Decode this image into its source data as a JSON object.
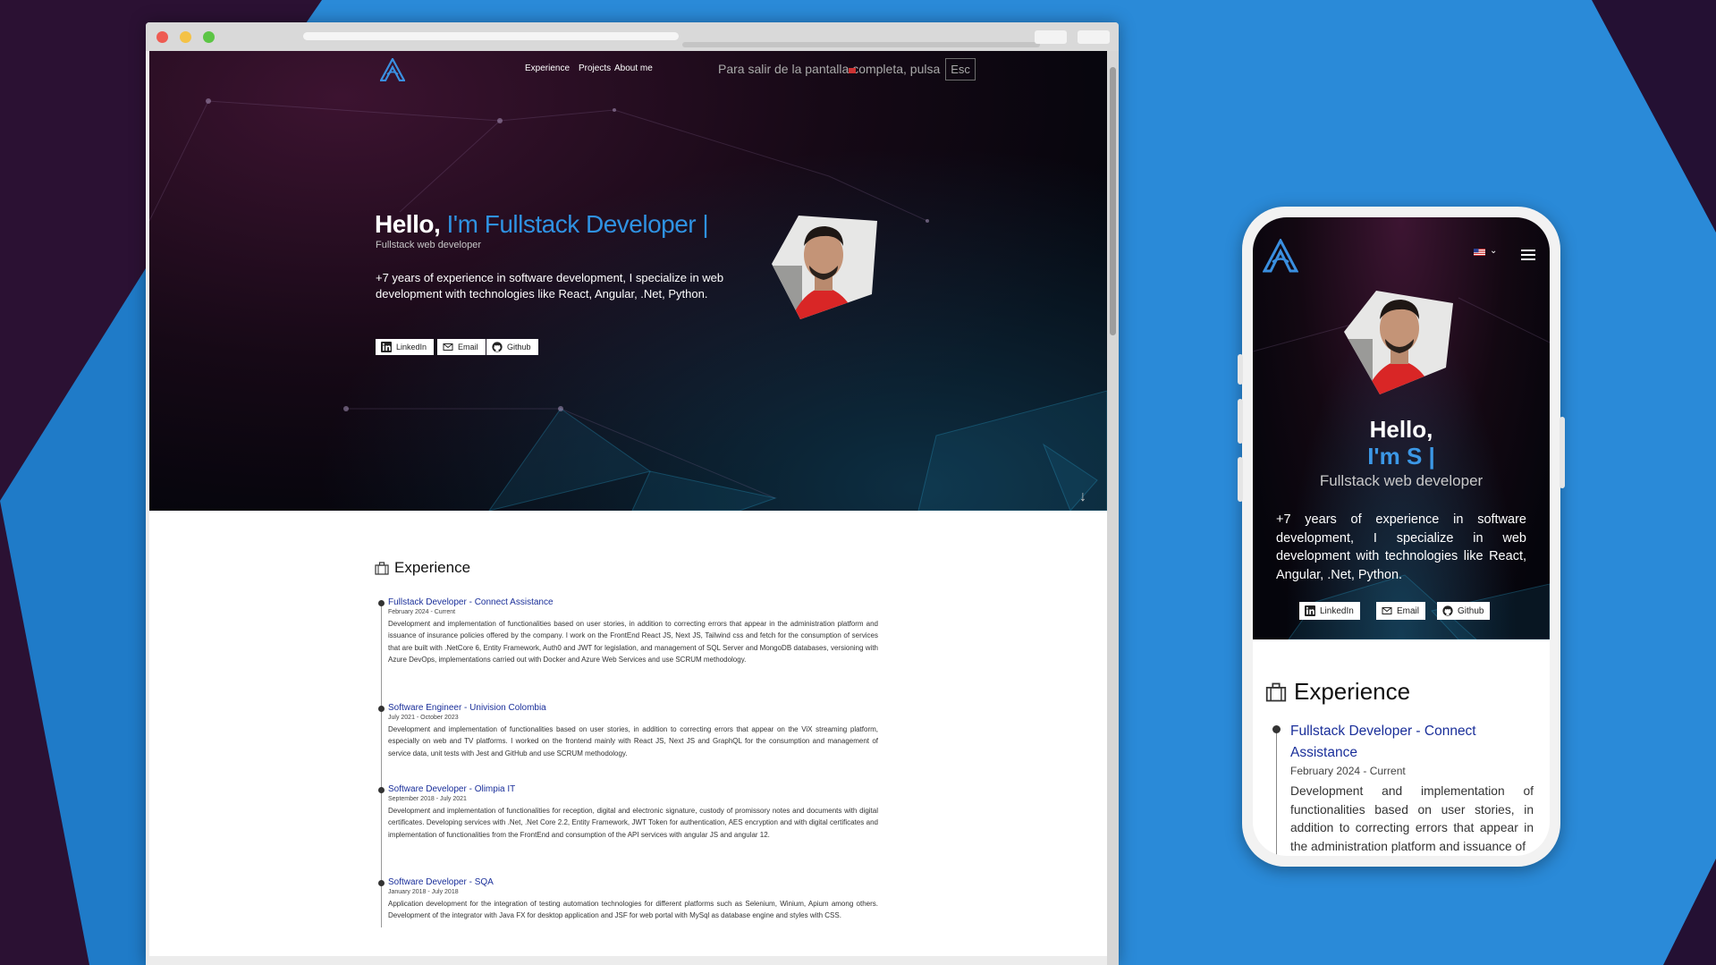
{
  "colors": {
    "background_blue": "#2a8ad8",
    "accent_blue": "#2f92e2",
    "job_title_blue": "#1a2f9a",
    "hero_dark": "#06060d"
  },
  "desktop": {
    "nav": {
      "experience": "Experience",
      "projects": "Projects",
      "about": "About me"
    },
    "fullscreen_notice": {
      "text": "Para salir de la pantalla completa, pulsa",
      "key": "Esc"
    },
    "hero": {
      "hello": "Hello,",
      "headline": "I'm Fullstack Developer |",
      "subtitle": "Fullstack web developer",
      "description": "+7 years of experience in software development, I specialize in web development with technologies like React, Angular, .Net, Python.",
      "social": [
        {
          "label": "LinkedIn",
          "icon": "linkedin-icon"
        },
        {
          "label": "Email",
          "icon": "mail-icon"
        },
        {
          "label": "Github",
          "icon": "github-icon"
        }
      ]
    },
    "experience": {
      "heading": "Experience",
      "jobs": [
        {
          "title": "Fullstack Developer - Connect Assistance",
          "date": "February 2024 - Current",
          "description": "Development and implementation of functionalities based on user stories, in addition to correcting errors that appear in the administration platform and issuance of insurance policies offered by the company. I work on the FrontEnd React JS, Next JS, Tailwind css and fetch for the consumption of services that are built with .NetCore 6, Entity Framework, Auth0 and JWT for legislation, and management of SQL Server and MongoDB databases, versioning with Azure DevOps, implementations carried out with Docker and Azure Web Services and use SCRUM methodology."
        },
        {
          "title": "Software Engineer - Univision Colombia",
          "date": "July 2021 - October 2023",
          "description": "Development and implementation of functionalities based on user stories, in addition to correcting errors that appear on the ViX streaming platform, especially on web and TV platforms. I worked on the frontend mainly with React JS, Next JS and GraphQL for the consumption and management of service data, unit tests with Jest and GitHub and use SCRUM methodology."
        },
        {
          "title": "Software Developer - Olimpia IT",
          "date": "September 2018 - July 2021",
          "description": "Development and implementation of functionalities for reception, digital and electronic signature, custody of promissory notes and documents with digital certificates. Developing services with .Net, .Net Core 2.2, Entity Framework, JWT Token for authentication, AES encryption and with digital certificates and implementation of functionalities from the FrontEnd and consumption of the API services with angular JS and angular 12."
        },
        {
          "title": "Software Developer - SQA",
          "date": "January 2018 - July 2018",
          "description": "Application development for the integration of testing automation technologies for different platforms such as Selenium, Winium, Apium among others. Development of the integrator with Java FX for desktop application and JSF for web portal with MySql as database engine and styles with CSS."
        }
      ]
    }
  },
  "mobile": {
    "hero": {
      "hello": "Hello,",
      "headline": "I'm S |",
      "subtitle": "Fullstack web developer",
      "description": "+7 years of experience in software development, I specialize in web development with technologies like React, Angular, .Net, Python.",
      "social": [
        {
          "label": "LinkedIn",
          "icon": "linkedin-icon"
        },
        {
          "label": "Email",
          "icon": "mail-icon"
        },
        {
          "label": "Github",
          "icon": "github-icon"
        }
      ]
    },
    "experience": {
      "heading": "Experience",
      "first_job": {
        "title": "Fullstack Developer - Connect Assistance",
        "date": "February 2024 - Current",
        "description": "Development and implementation of functionalities based on user stories, in addition to correcting errors that appear in the administration platform and issuance of"
      }
    }
  }
}
